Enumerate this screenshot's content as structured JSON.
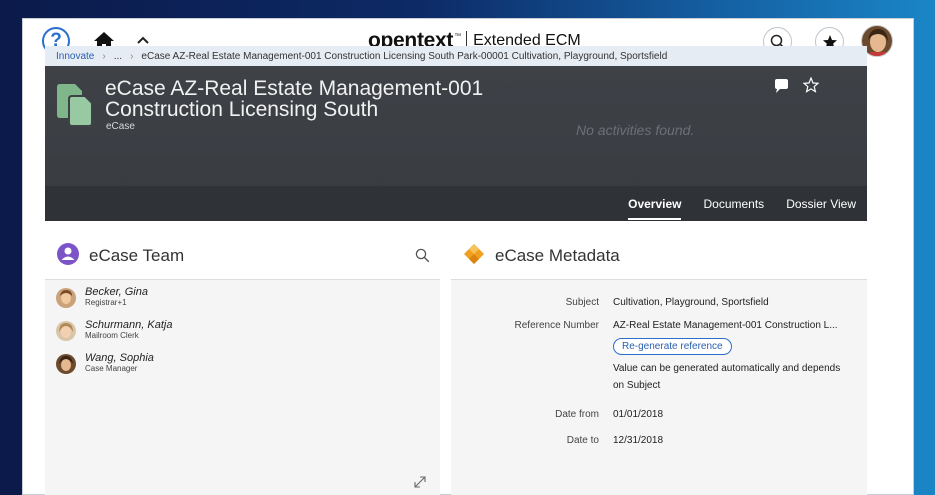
{
  "topbar": {
    "help_glyph": "?",
    "brand_name": "opentext",
    "brand_tm": "™",
    "product_name": "Extended ECM",
    "icons": [
      "help-icon",
      "home-icon",
      "chevron-up-icon",
      "search-icon",
      "star-icon",
      "user-avatar"
    ]
  },
  "breadcrumb": {
    "items": [
      "Innovate",
      "...",
      "eCase AZ-Real Estate Management-001 Construction Licensing South Park-00001 Cultivation, Playground, Sportsfield"
    ],
    "separator": "›"
  },
  "case_header": {
    "title": "eCase  AZ-Real Estate Management-001 Construction Licensing South",
    "subtitle": "eCase",
    "activity_empty": "No activities found.",
    "tabs": [
      {
        "label": "Overview",
        "active": true
      },
      {
        "label": "Documents",
        "active": false
      },
      {
        "label": "Dossier View",
        "active": false
      }
    ]
  },
  "team_card": {
    "title": "eCase Team",
    "members": [
      {
        "name": "Becker, Gina",
        "role": "Registrar+1"
      },
      {
        "name": "Schurmann, Katja",
        "role": "Mailroom Clerk"
      },
      {
        "name": "Wang, Sophia",
        "role": "Case Manager"
      }
    ]
  },
  "metadata_card": {
    "title": "eCase Metadata",
    "subject_label": "Subject",
    "subject_value": "Cultivation, Playground, Sportsfield",
    "reference_label": "Reference Number",
    "reference_value": "AZ-Real Estate Management-001 Construction L...",
    "regenerate_label": "Re-generate reference",
    "hint_text": "Value can be generated automatically and depends on Subject",
    "date_from_label": "Date from",
    "date_from_value": "01/01/2018",
    "date_to_label": "Date to",
    "date_to_value": "12/31/2018"
  },
  "colors": {
    "accent_blue": "#2a6fce",
    "team_icon": "#7b55c7",
    "metadata_icon": "#f0a020",
    "header_bg": "#3e4247",
    "case_icon_green": "#7fb68a"
  }
}
